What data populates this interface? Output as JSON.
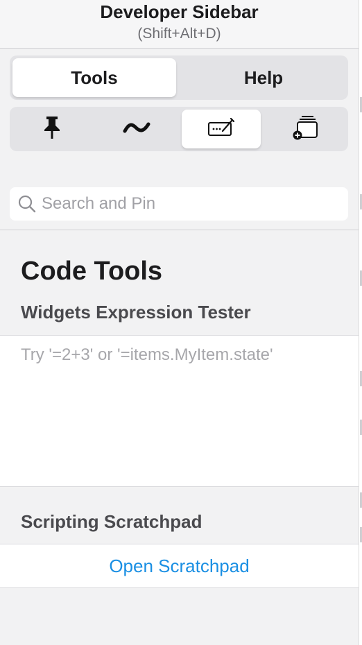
{
  "header": {
    "title": "Developer Sidebar",
    "shortcut": "(Shift+Alt+D)"
  },
  "main_tabs": [
    {
      "label": "Tools",
      "selected": true
    },
    {
      "label": "Help",
      "selected": false
    }
  ],
  "tool_icons": [
    {
      "icon": "pin-icon",
      "selected": false
    },
    {
      "icon": "wave-icon",
      "selected": false
    },
    {
      "icon": "code-edit-icon",
      "selected": true
    },
    {
      "icon": "add-widget-icon",
      "selected": false
    }
  ],
  "search": {
    "placeholder": "Search and Pin",
    "value": ""
  },
  "code_tools": {
    "title": "Code Tools",
    "expression_tester": {
      "title": "Widgets Expression Tester",
      "placeholder": "Try '=2+3' or '=items.MyItem.state'",
      "value": ""
    },
    "scratchpad": {
      "title": "Scripting Scratchpad",
      "open_label": "Open Scratchpad"
    }
  },
  "colors": {
    "accent": "#1a8fe3",
    "background": "#f2f2f3",
    "segment_bg": "#e3e3e6"
  }
}
